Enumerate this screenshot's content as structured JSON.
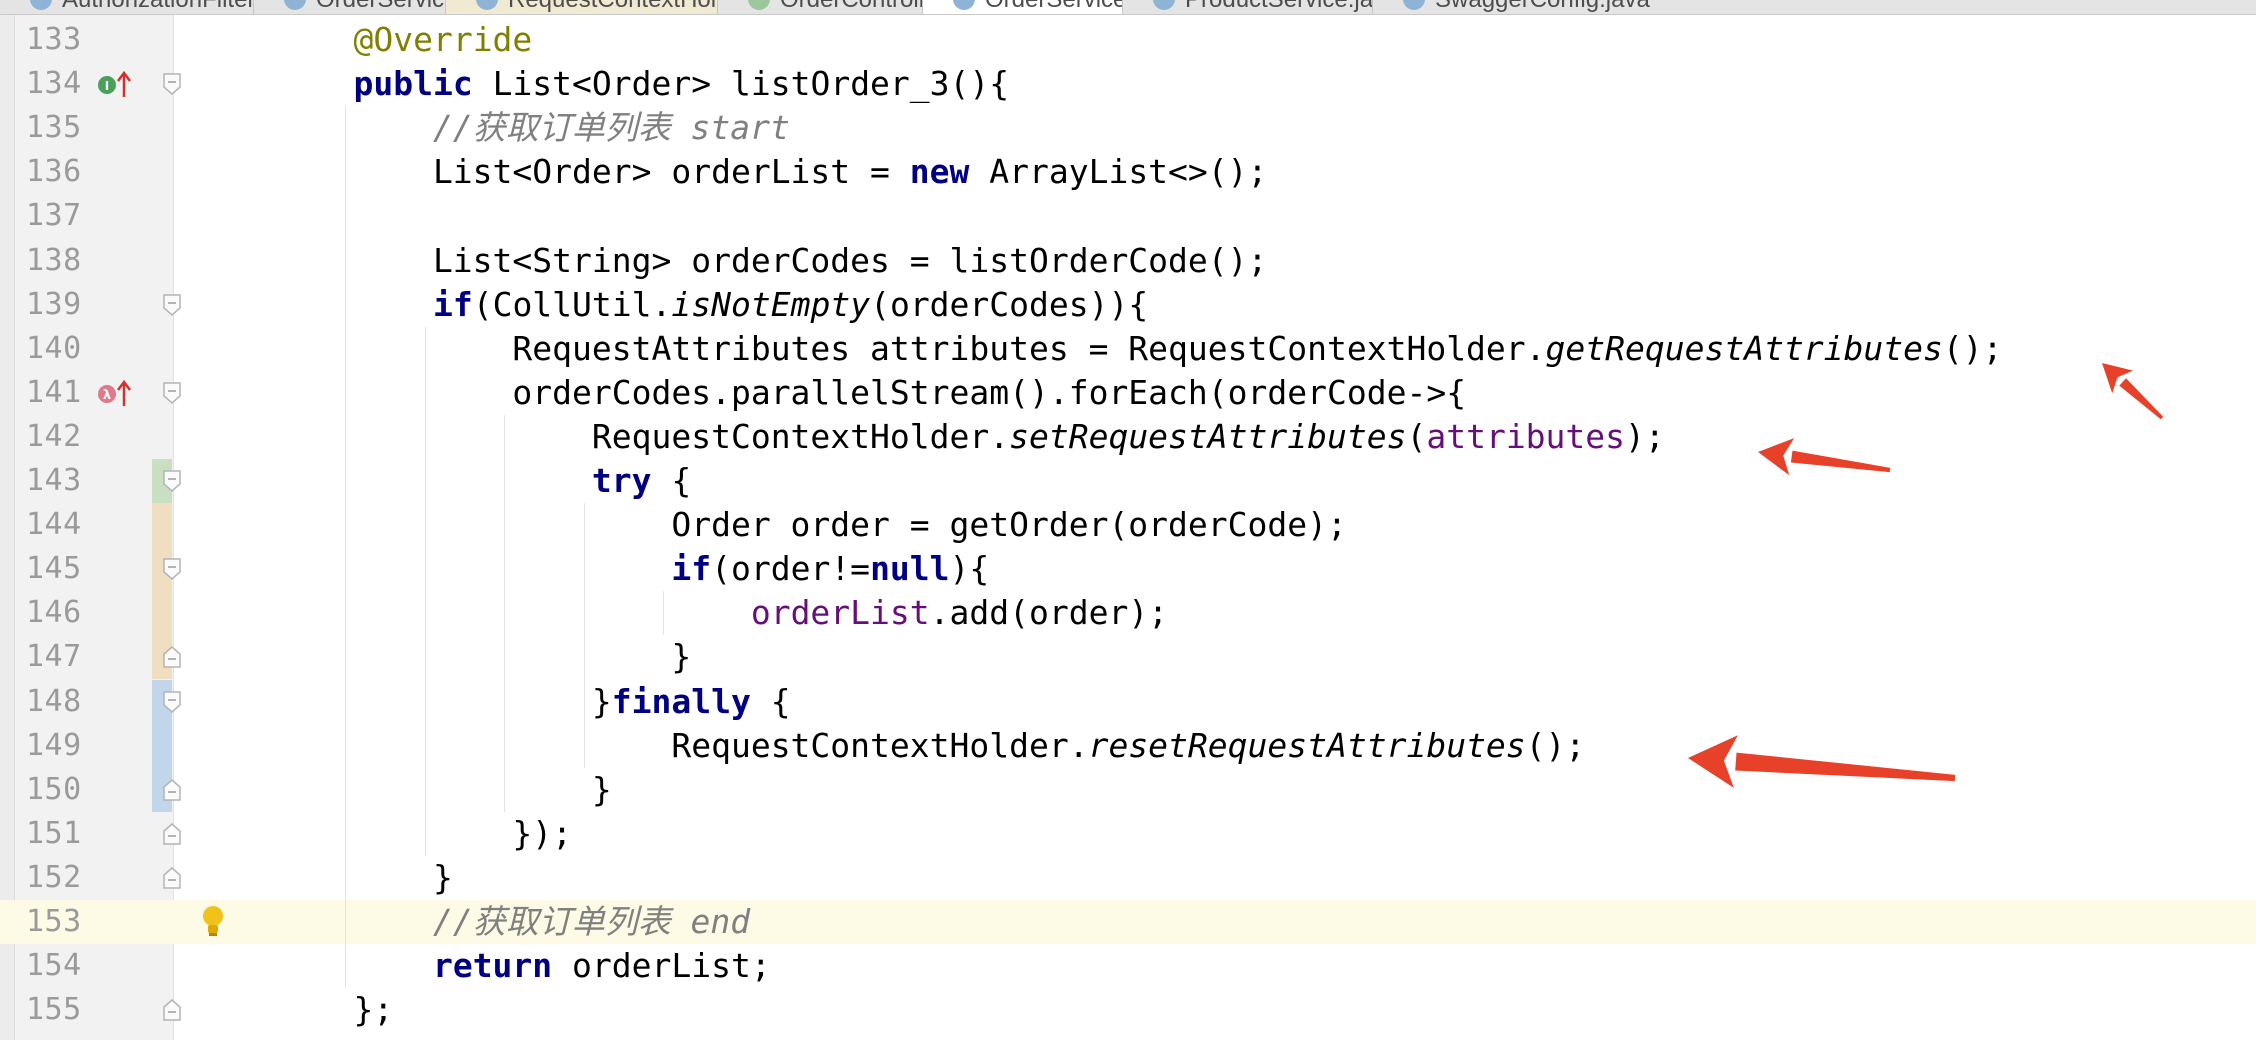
{
  "tabs": [
    {
      "label": "AuthorizationFilter.java"
    },
    {
      "label": "OrderService.java"
    },
    {
      "label": "RequestContextHolder.java"
    },
    {
      "label": "OrderController.java"
    },
    {
      "label": "OrderServiceImpl.java",
      "active": true
    },
    {
      "label": "ProductService.java"
    },
    {
      "label": "SwaggerConfig.java"
    }
  ],
  "editor": {
    "lines": [
      {
        "num": "133",
        "tokens": [
          {
            "t": "    "
          },
          {
            "t": "@Override",
            "c": "an"
          }
        ]
      },
      {
        "num": "134",
        "tokens": [
          {
            "t": "    "
          },
          {
            "t": "public",
            "c": "kw"
          },
          {
            "t": " List<Order> listOrder_3(){"
          }
        ]
      },
      {
        "num": "135",
        "tokens": [
          {
            "t": "        "
          },
          {
            "t": "//获取订单列表 start",
            "c": "cm"
          }
        ]
      },
      {
        "num": "136",
        "tokens": [
          {
            "t": "        List<Order> orderList = "
          },
          {
            "t": "new",
            "c": "kw"
          },
          {
            "t": " ArrayList<>();"
          }
        ]
      },
      {
        "num": "137",
        "tokens": []
      },
      {
        "num": "138",
        "tokens": [
          {
            "t": "        List<String> orderCodes = listOrderCode();"
          }
        ]
      },
      {
        "num": "139",
        "tokens": [
          {
            "t": "        "
          },
          {
            "t": "if",
            "c": "kw"
          },
          {
            "t": "(CollUtil."
          },
          {
            "t": "isNotEmpty",
            "c": "it"
          },
          {
            "t": "(orderCodes)){"
          }
        ]
      },
      {
        "num": "140",
        "tokens": [
          {
            "t": "            RequestAttributes attributes = RequestContextHolder."
          },
          {
            "t": "getRequestAttributes",
            "c": "it"
          },
          {
            "t": "();"
          }
        ]
      },
      {
        "num": "141",
        "tokens": [
          {
            "t": "            orderCodes.parallelStream().forEach(orderCode->{"
          }
        ]
      },
      {
        "num": "142",
        "tokens": [
          {
            "t": "                RequestContextHolder."
          },
          {
            "t": "setRequestAttributes",
            "c": "it"
          },
          {
            "t": "("
          },
          {
            "t": "attributes",
            "c": "fld"
          },
          {
            "t": ");"
          }
        ]
      },
      {
        "num": "143",
        "tokens": [
          {
            "t": "                "
          },
          {
            "t": "try",
            "c": "kw"
          },
          {
            "t": " {"
          }
        ]
      },
      {
        "num": "144",
        "tokens": [
          {
            "t": "                    Order order = getOrder(orderCode);"
          }
        ]
      },
      {
        "num": "145",
        "tokens": [
          {
            "t": "                    "
          },
          {
            "t": "if",
            "c": "kw"
          },
          {
            "t": "(order!="
          },
          {
            "t": "null",
            "c": "kw"
          },
          {
            "t": "){"
          }
        ]
      },
      {
        "num": "146",
        "tokens": [
          {
            "t": "                        "
          },
          {
            "t": "orderList",
            "c": "fld"
          },
          {
            "t": ".add(order);"
          }
        ]
      },
      {
        "num": "147",
        "tokens": [
          {
            "t": "                    }"
          }
        ]
      },
      {
        "num": "148",
        "tokens": [
          {
            "t": "                }"
          },
          {
            "t": "finally",
            "c": "kw"
          },
          {
            "t": " {"
          }
        ]
      },
      {
        "num": "149",
        "tokens": [
          {
            "t": "                    RequestContextHolder."
          },
          {
            "t": "resetRequestAttributes",
            "c": "it"
          },
          {
            "t": "();"
          }
        ]
      },
      {
        "num": "150",
        "tokens": [
          {
            "t": "                }"
          }
        ]
      },
      {
        "num": "151",
        "tokens": [
          {
            "t": "            });"
          }
        ]
      },
      {
        "num": "152",
        "tokens": [
          {
            "t": "        }"
          }
        ]
      },
      {
        "num": "153",
        "tokens": [
          {
            "t": "        "
          },
          {
            "t": "//获取订单列表 end",
            "c": "cm"
          }
        ],
        "current": true
      },
      {
        "num": "154",
        "tokens": [
          {
            "t": "        "
          },
          {
            "t": "return",
            "c": "kw"
          },
          {
            "t": " orderList;"
          }
        ]
      },
      {
        "num": "155",
        "tokens": [
          {
            "t": "    };"
          }
        ]
      }
    ]
  },
  "gutter_icons": {
    "134": "implements-method-icon",
    "141": "lambda-icon",
    "153": "intention-bulb-icon"
  },
  "fold_markers": [
    "134",
    "139",
    "141",
    "143",
    "145",
    "147",
    "148",
    "150",
    "151",
    "152",
    "155"
  ],
  "vcs_changes": [
    {
      "from": "143",
      "to": "143",
      "kind": "added",
      "color": "#c9dfc2"
    },
    {
      "from": "144",
      "to": "147",
      "kind": "modified",
      "color": "#efdfc0"
    },
    {
      "from": "148",
      "to": "150",
      "kind": "changed",
      "color": "#c1d6ea"
    }
  ],
  "annotations": {
    "arrow_color": "#e8412a",
    "arrows_point_to_lines": [
      "140",
      "142",
      "149"
    ]
  }
}
